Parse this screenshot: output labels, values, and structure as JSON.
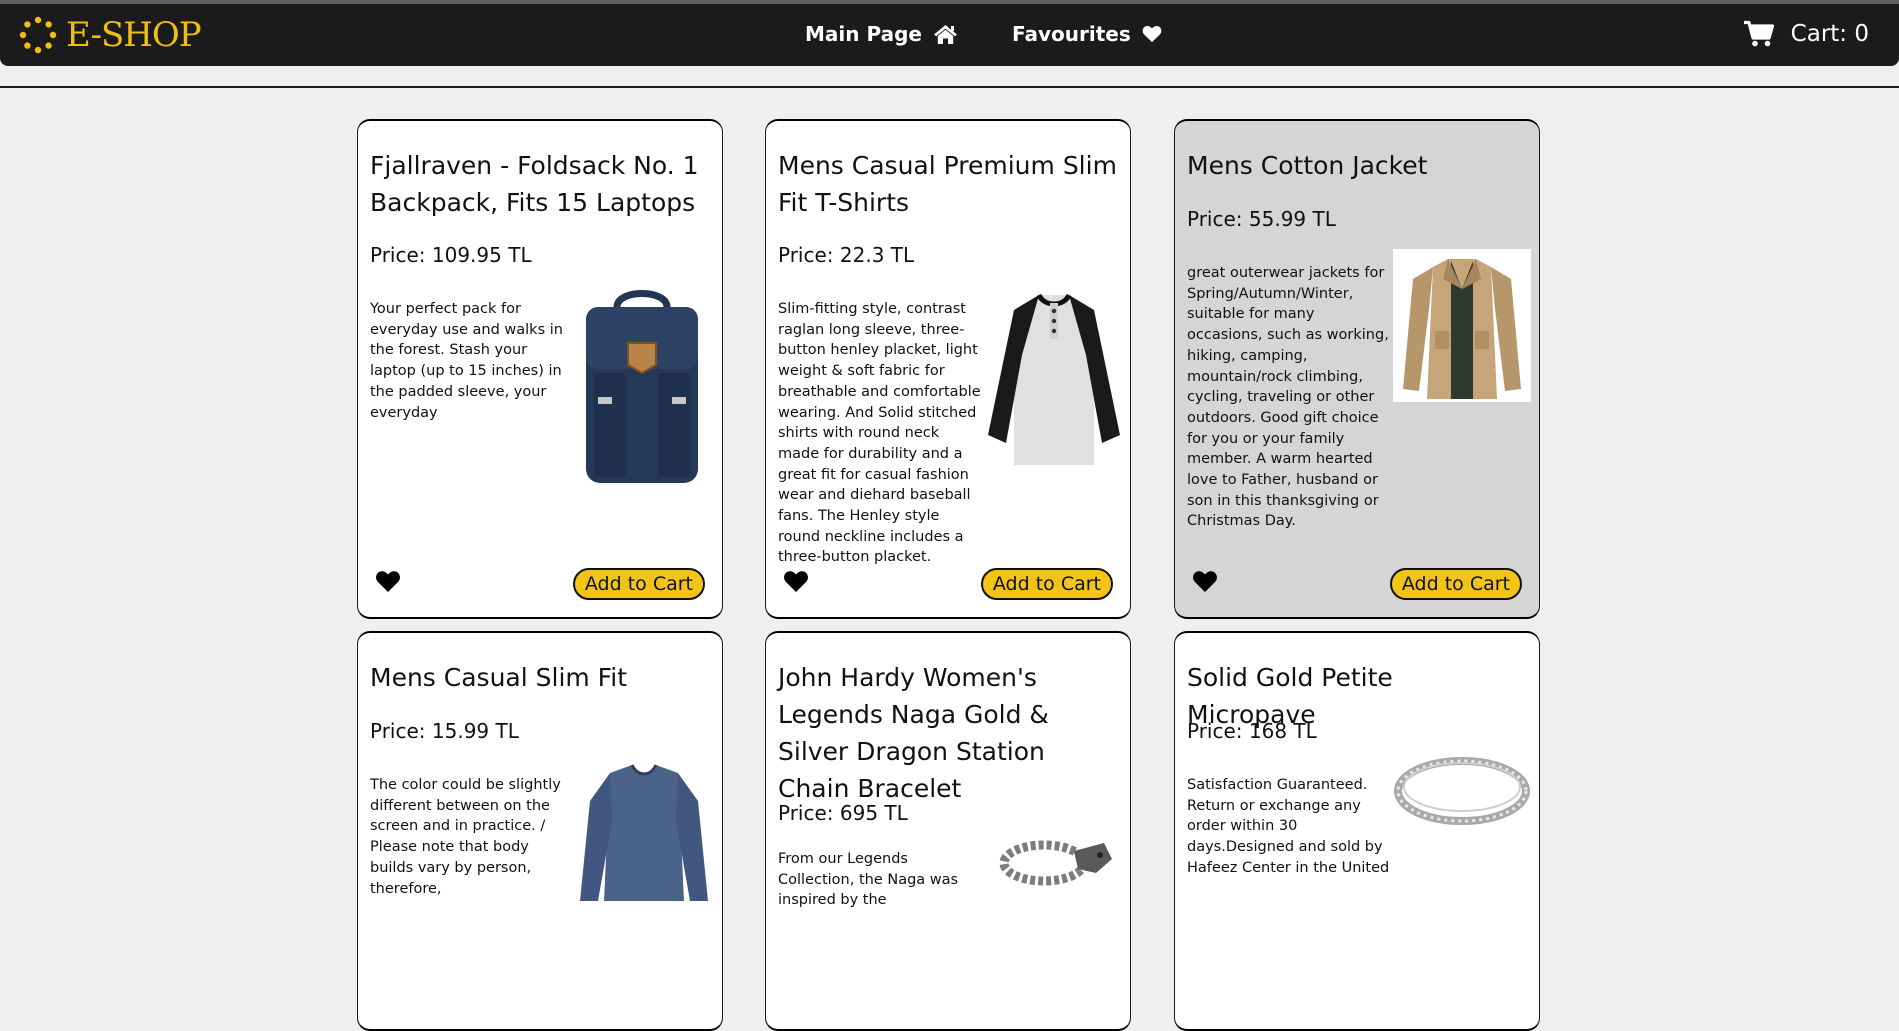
{
  "brand": {
    "name": "E-SHOP",
    "accent": "#f1bf12"
  },
  "nav": {
    "main_page": "Main Page",
    "favourites": "Favourites",
    "cart": "Cart: 0"
  },
  "icons": {
    "logo": "spinner-dots-icon",
    "main_page": "home-icon",
    "favourites": "heart-icon",
    "cart": "shopping-cart-icon",
    "favourite_toggle": "heart-icon"
  },
  "add_to_cart_label": "Add to Cart",
  "products": [
    {
      "title": "Fjallraven - Foldsack No. 1 Backpack, Fits 15 Laptops",
      "price": "Price: 109.95 TL",
      "description": "Your perfect pack for everyday use and walks in the forest. Stash your laptop (up to 15 inches) in the padded sleeve, your everyday",
      "image": "backpack"
    },
    {
      "title": "Mens Casual Premium Slim Fit T-Shirts",
      "price": "Price: 22.3 TL",
      "description": "Slim-fitting style, contrast raglan long sleeve, three-button henley placket, light weight & soft fabric for breathable and comfortable wearing. And Solid stitched shirts with round neck made for durability and a great fit for casual fashion wear and diehard baseball fans. The Henley style round neckline includes a three-button placket.",
      "image": "raglan-tshirt"
    },
    {
      "title": "Mens Cotton Jacket",
      "price": "Price: 55.99 TL",
      "description": "great outerwear jackets for Spring/Autumn/Winter, suitable for many occasions, such as working, hiking, camping, mountain/rock climbing, cycling, traveling or other outdoors. Good gift choice for you or your family member. A warm hearted love to Father, husband or son in this thanksgiving or Christmas Day.",
      "image": "cotton-jacket"
    },
    {
      "title": "Mens Casual Slim Fit",
      "price": "Price: 15.99 TL",
      "description": "The color could be slightly different between on the screen and in practice. / Please note that body builds vary by person, therefore,",
      "image": "slim-fit-sweater"
    },
    {
      "title": "John Hardy Women's Legends Naga Gold & Silver Dragon Station Chain Bracelet",
      "price": "Price: 695 TL",
      "description": "From our Legends Collection, the Naga was inspired by the",
      "image": "dragon-bracelet"
    },
    {
      "title": "Solid Gold Petite Micropave",
      "price": "Price: 168 TL",
      "description": "Satisfaction Guaranteed. Return or exchange any order within 30 days.Designed and sold by Hafeez Center in the United",
      "image": "silver-ring"
    }
  ]
}
